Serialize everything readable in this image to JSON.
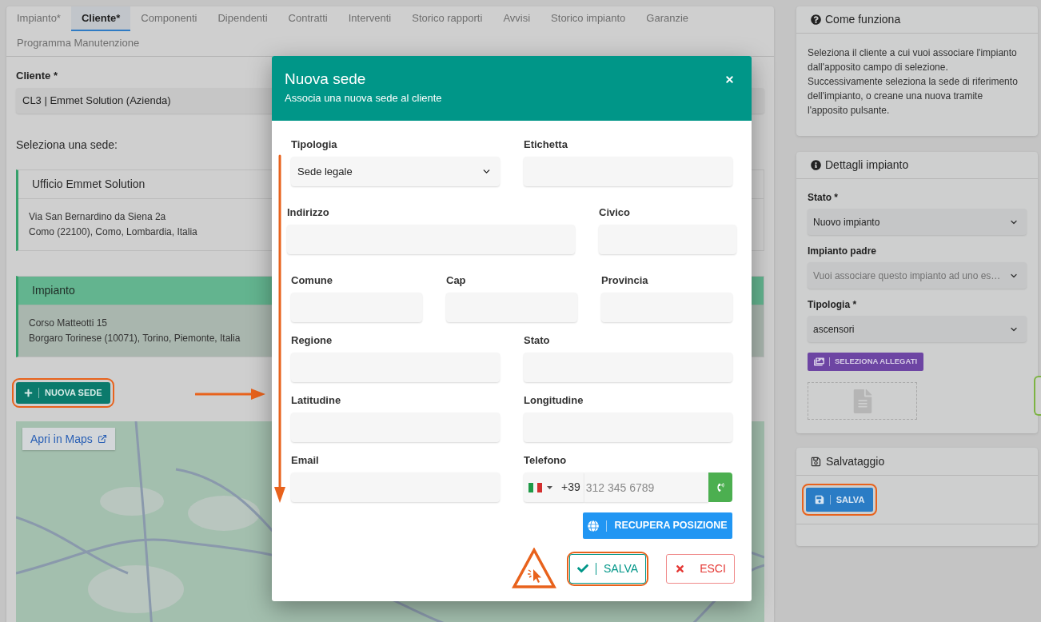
{
  "tabs": [
    {
      "label": "Impianto*",
      "selected": false
    },
    {
      "label": "Cliente*",
      "selected": true
    },
    {
      "label": "Componenti",
      "selected": false
    },
    {
      "label": "Dipendenti",
      "selected": false
    },
    {
      "label": "Contratti",
      "selected": false
    },
    {
      "label": "Interventi",
      "selected": false
    },
    {
      "label": "Storico rapporti",
      "selected": false
    },
    {
      "label": "Avvisi",
      "selected": false
    },
    {
      "label": "Storico impianto",
      "selected": false
    },
    {
      "label": "Garanzie",
      "selected": false
    },
    {
      "label": "Programma Manutenzione",
      "selected": false
    }
  ],
  "client": {
    "label": "Cliente *",
    "value": "CL3 | Emmet Solution (Azienda)"
  },
  "sites_heading": "Seleziona una sede:",
  "sites": [
    {
      "name": "Ufficio Emmet Solution",
      "lines": [
        "Via San Bernardino da Siena 2a",
        "Como (22100), Como, Lombardia, Italia"
      ],
      "selected": false
    },
    {
      "name": "Impianto",
      "lines": [
        "Corso Matteotti 15",
        "Borgaro Torinese (10071), Torino, Piemonte, Italia"
      ],
      "selected": true
    }
  ],
  "new_site_button": {
    "label": "NUOVA SEDE",
    "highlighted": true
  },
  "map": {
    "link": "Apri in Maps"
  },
  "help_card": {
    "title": "Come funziona",
    "paragraphs": [
      "Seleziona il cliente a cui vuoi associare l'impianto dall'apposito campo di selezione.",
      "Successivamente seleziona la sede di riferimento dell'impianto, o creane una nuova tramite l'apposito pulsante."
    ]
  },
  "details_card": {
    "title": "Dettagli impianto",
    "fields": [
      {
        "label": "Stato *",
        "value": "Nuovo impianto"
      },
      {
        "label": "Impianto padre",
        "placeholder": "Vuoi associare questo impianto ad uno es…"
      },
      {
        "label": "Tipologia *",
        "value": "ascensori"
      }
    ],
    "attach_button": "SELEZIONA ALLEGATI"
  },
  "save_card": {
    "title": "Salvataggio",
    "button": {
      "label": "SALVA",
      "highlighted": true
    }
  },
  "modal": {
    "title": "Nuova sede",
    "subtitle": "Associa una nuova sede al cliente",
    "rows": [
      [
        {
          "label": "Tipologia",
          "kind": "select",
          "value": "Sede legale"
        },
        {
          "label": "Etichetta",
          "kind": "text"
        }
      ],
      [
        {
          "label": "Indirizzo",
          "kind": "text"
        },
        {
          "label": "Civico",
          "kind": "text"
        }
      ],
      [
        {
          "label": "Comune",
          "kind": "text"
        },
        {
          "label": "Cap",
          "kind": "text"
        },
        {
          "label": "Provincia",
          "kind": "text"
        }
      ],
      [
        {
          "label": "Regione",
          "kind": "text"
        },
        {
          "label": "Stato",
          "kind": "text"
        }
      ],
      [
        {
          "label": "Latitudine",
          "kind": "text"
        },
        {
          "label": "Longitudine",
          "kind": "text"
        }
      ],
      [
        {
          "label": "Email",
          "kind": "text"
        },
        {
          "label": "Telefono",
          "kind": "phone",
          "prefix": "+39",
          "placeholder": "312 345 6789"
        }
      ]
    ],
    "locate_button": "RECUPERA POSIZIONE",
    "buttons": [
      {
        "kind": "save",
        "label": "SALVA",
        "highlighted": true
      },
      {
        "kind": "exit",
        "label": "ESCI",
        "highlighted": false
      }
    ]
  }
}
